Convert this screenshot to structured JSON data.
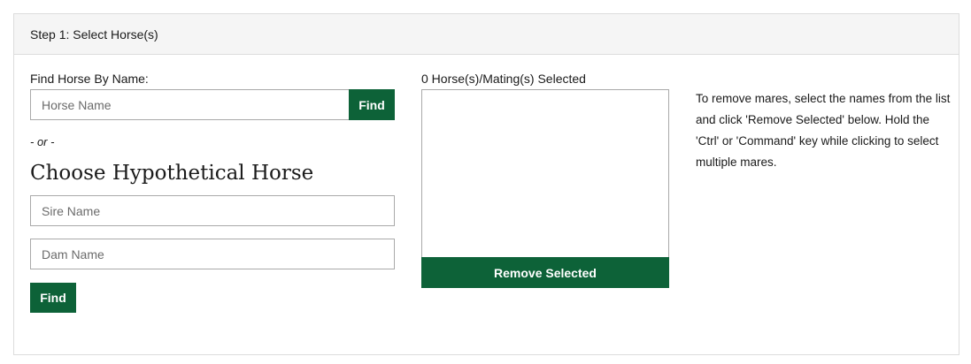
{
  "step": {
    "title": "Step 1: Select Horse(s)"
  },
  "find_by_name": {
    "label": "Find Horse By Name:",
    "placeholder": "Horse Name",
    "button": "Find"
  },
  "or_text": "- or -",
  "hypothetical": {
    "heading": "Choose Hypothetical Horse",
    "sire_placeholder": "Sire Name",
    "dam_placeholder": "Dam Name",
    "button": "Find"
  },
  "selection": {
    "count_label": "0 Horse(s)/Mating(s) Selected",
    "remove_button": "Remove Selected",
    "help_text": "To remove mares, select the names from the list and click 'Remove Selected' below. Hold the 'Ctrl' or 'Command' key while clicking to select multiple mares."
  },
  "colors": {
    "accent": "#0d6238",
    "header_bg": "#f5f5f5",
    "border": "#dcdcdc"
  }
}
